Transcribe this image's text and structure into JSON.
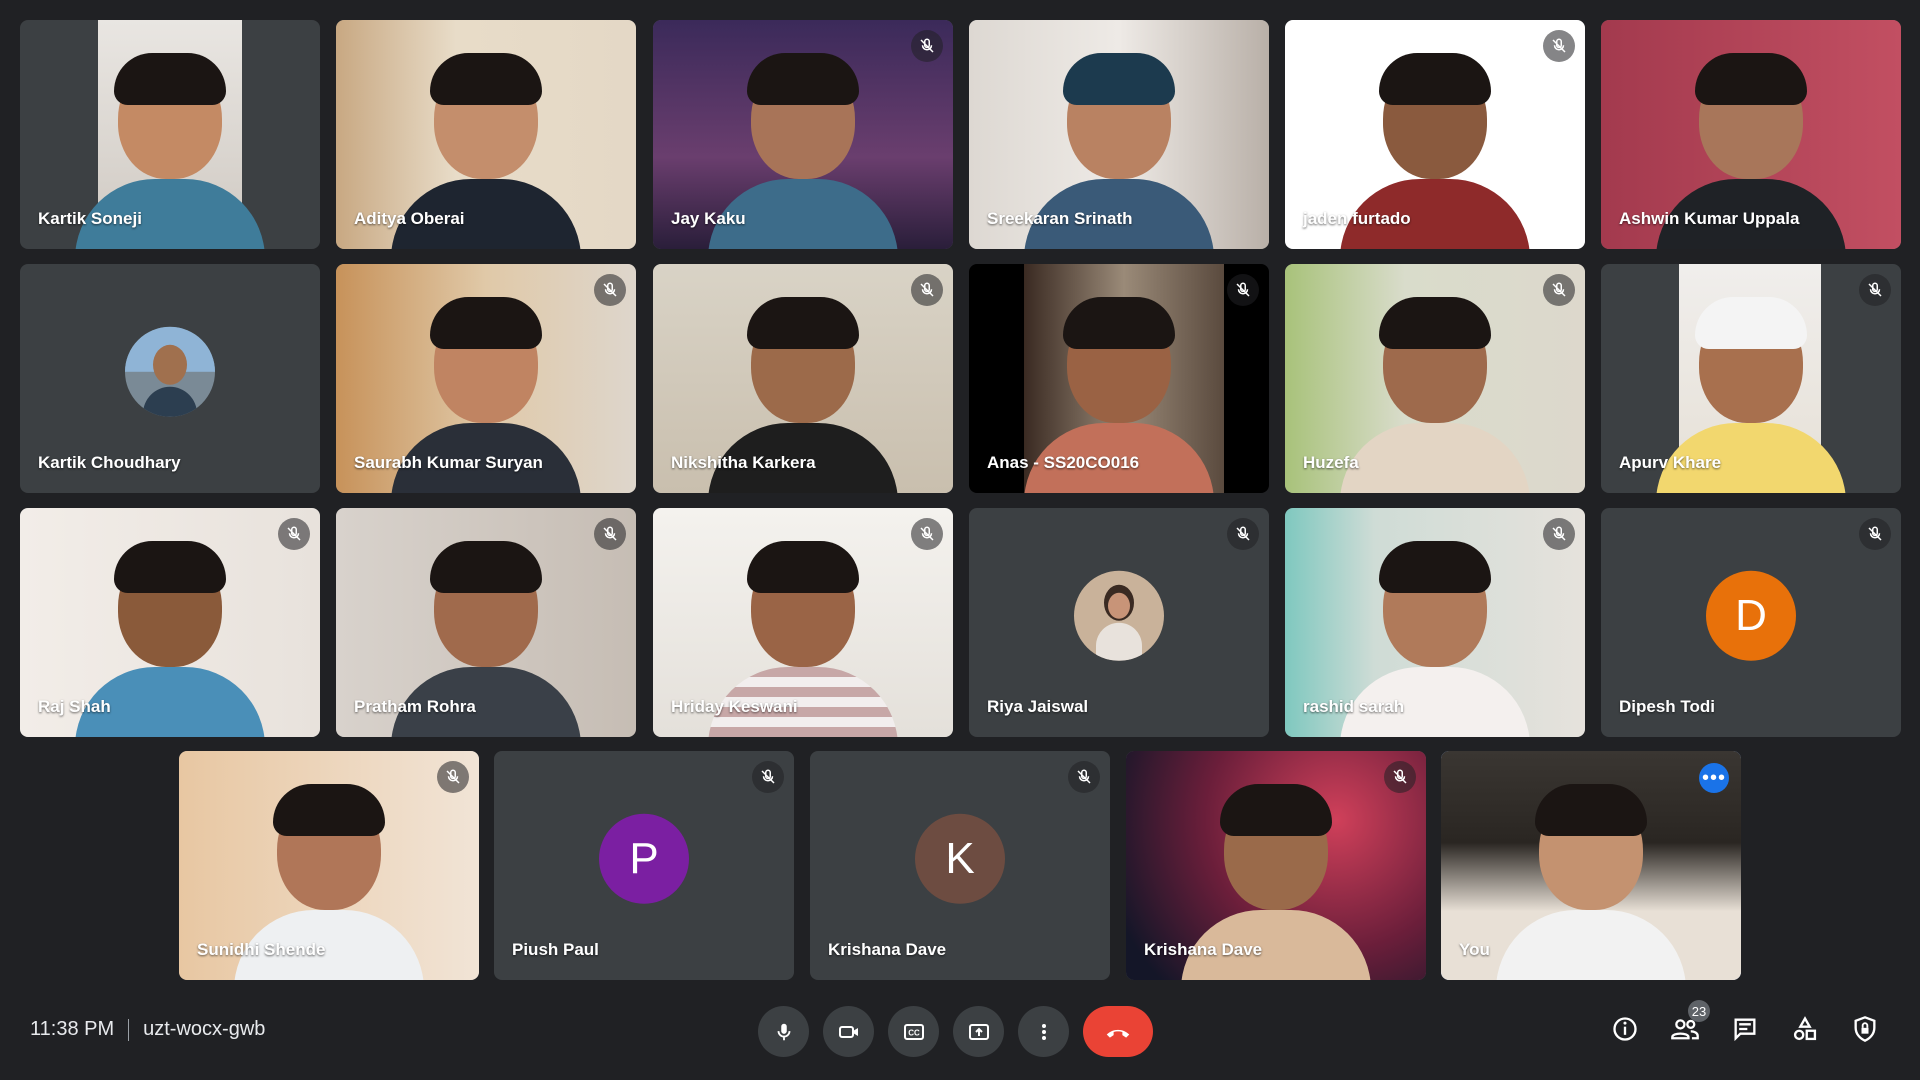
{
  "meeting": {
    "time": "11:38 PM",
    "code": "uzt-wocx-gwb",
    "participant_count": "23"
  },
  "colors": {
    "accent_blue": "#1a73e8",
    "self_outline": "#8ab4f8",
    "end_call_red": "#ea4335",
    "tile_bg": "#3c4043",
    "page_bg": "#202124"
  },
  "tiles": [
    {
      "name": "Kartik Soneji",
      "muted": false,
      "kind": "video"
    },
    {
      "name": "Aditya Oberai",
      "muted": false,
      "kind": "video"
    },
    {
      "name": "Jay Kaku",
      "muted": true,
      "kind": "video"
    },
    {
      "name": "Sreekaran Srinath",
      "muted": false,
      "kind": "video"
    },
    {
      "name": "jaden furtado",
      "muted": true,
      "kind": "video"
    },
    {
      "name": "Ashwin Kumar Uppala",
      "muted": false,
      "kind": "video"
    },
    {
      "name": "Kartik Choudhary",
      "muted": false,
      "kind": "photo-avatar"
    },
    {
      "name": "Saurabh Kumar Suryan",
      "muted": true,
      "kind": "video"
    },
    {
      "name": "Nikshitha Karkera",
      "muted": true,
      "kind": "video"
    },
    {
      "name": "Anas - SS20CO016",
      "muted": true,
      "kind": "video"
    },
    {
      "name": "Huzefa",
      "muted": true,
      "kind": "video"
    },
    {
      "name": "Apurv Khare",
      "muted": true,
      "kind": "video"
    },
    {
      "name": "Raj Shah",
      "muted": true,
      "kind": "video"
    },
    {
      "name": "Pratham Rohra",
      "muted": true,
      "kind": "video"
    },
    {
      "name": "Hriday Keswani",
      "muted": true,
      "kind": "video"
    },
    {
      "name": "Riya Jaiswal",
      "muted": true,
      "kind": "photo-avatar"
    },
    {
      "name": "rashid sarah",
      "muted": true,
      "kind": "video"
    },
    {
      "name": "Dipesh Todi",
      "muted": true,
      "kind": "letter-avatar",
      "letter": "D",
      "color": "#e8710a"
    },
    {
      "name": "Sunidhi Shende",
      "muted": true,
      "kind": "video"
    },
    {
      "name": "Piush Paul",
      "muted": true,
      "kind": "letter-avatar",
      "letter": "P",
      "color": "#7b1fa2"
    },
    {
      "name": "Krishana Dave",
      "muted": true,
      "kind": "letter-avatar",
      "letter": "K",
      "color": "#6d4c41"
    },
    {
      "name": "Krishana Dave",
      "muted": true,
      "kind": "video"
    },
    {
      "name": "You",
      "muted": false,
      "kind": "self"
    }
  ],
  "controls": [
    {
      "name": "microphone-button",
      "icon": "microphone-icon"
    },
    {
      "name": "camera-button",
      "icon": "camera-icon"
    },
    {
      "name": "captions-button",
      "icon": "captions-icon"
    },
    {
      "name": "present-button",
      "icon": "present-icon"
    },
    {
      "name": "more-options-button",
      "icon": "more-vert-icon"
    },
    {
      "name": "leave-call-button",
      "icon": "hangup-icon"
    }
  ],
  "right_icons": [
    {
      "name": "meeting-details-button",
      "icon": "info-icon"
    },
    {
      "name": "people-button",
      "icon": "people-icon"
    },
    {
      "name": "chat-button",
      "icon": "chat-icon"
    },
    {
      "name": "activities-button",
      "icon": "activities-icon"
    },
    {
      "name": "host-controls-button",
      "icon": "shield-icon"
    }
  ]
}
